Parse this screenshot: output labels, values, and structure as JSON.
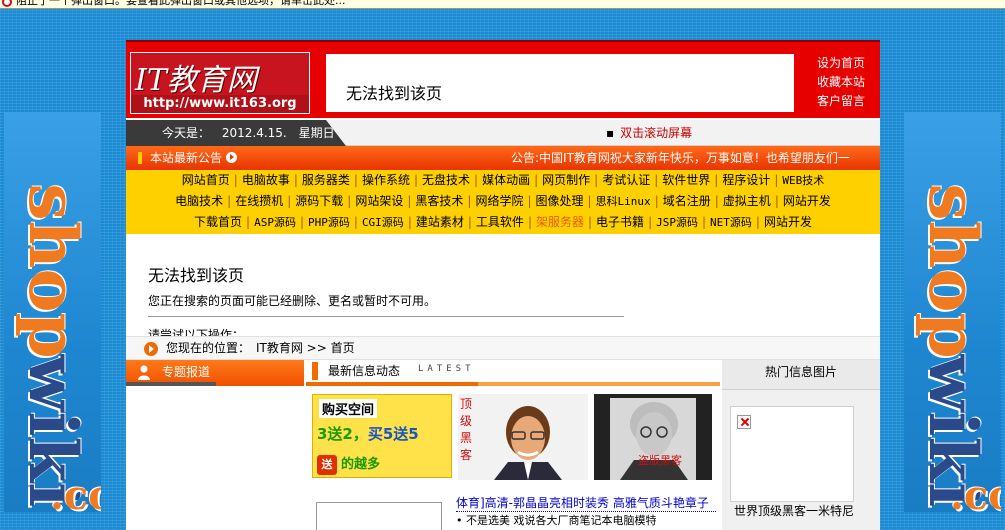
{
  "infobar": {
    "message": "阻止了一个弹出窗口。要查看此弹出窗口或其他选项，请单击此处..."
  },
  "side_banner": {
    "word_top": "shop",
    "word_mid": "wiki",
    "word_bottom": ".com"
  },
  "header": {
    "logo_title": "IT教育网",
    "logo_url": "http://www.it163.org",
    "frame_title": "无法找到该页",
    "links": [
      "设为首页",
      "收藏本站",
      "客户留言"
    ]
  },
  "datebar": {
    "today_label": "今天是：",
    "date": "2012.4.15.",
    "weekday": "星期日",
    "scroll_toggle": "双击滚动屏幕"
  },
  "announce": {
    "label": "本站最新公告",
    "text": "公告:中国IT教育网祝大家新年快乐，万事如意！也希望朋友们一"
  },
  "nav": {
    "row1": [
      "网站首页",
      "电脑故事",
      "服务器类",
      "操作系统",
      "无盘技术",
      "媒体动画",
      "网页制作",
      "考试认证",
      "软件世界",
      "程序设计",
      "WEB技术"
    ],
    "row2": [
      "电脑技术",
      "在线攒机",
      "源码下载",
      "网站架设",
      "黑客技术",
      "网络学院",
      "图像处理",
      "思科Linux",
      "域名注册",
      "虚拟主机",
      "网站开发"
    ],
    "row3": [
      "下载首页",
      "ASP源码",
      "PHP源码",
      "CGI源码",
      "建站素材",
      "工具软件",
      "架服务器",
      "电子书籍",
      "JSP源码",
      "NET源码",
      "网站开发"
    ]
  },
  "error": {
    "title": "无法找到该页",
    "description": "您正在搜索的页面可能已经删除、更名或暂时不可用。",
    "cut_text": "请尝试以下操作："
  },
  "location": {
    "label": "您现在的位置：",
    "crumb": "IT教育网 >> 首页"
  },
  "special": {
    "label": "专题报道"
  },
  "news": {
    "label": "最新信息动态",
    "latest": "LATEST",
    "promo_title": "购买空间",
    "promo_offer_1": "3送2，",
    "promo_offer_2": "买5送5",
    "promo_icon": "送",
    "promo_tag": "的越多",
    "photo1_caption": "顶级黑客",
    "photo2_caption": "盗版黑客",
    "headline": "体育]高清-郭晶晶亮相时装秀 高雅气质斗艳章子",
    "headline_sub": "• 不是选美 戏说各大厂商笔记本电脑模特"
  },
  "hot": {
    "label": "热门信息图片",
    "caption": "世界顶级黑客一米特尼"
  },
  "colors": {
    "header_red": "#e60000",
    "nav_yellow": "#ffd000",
    "announce_orange": "#ff6a1a",
    "page_blue": "#1c8ad3"
  }
}
